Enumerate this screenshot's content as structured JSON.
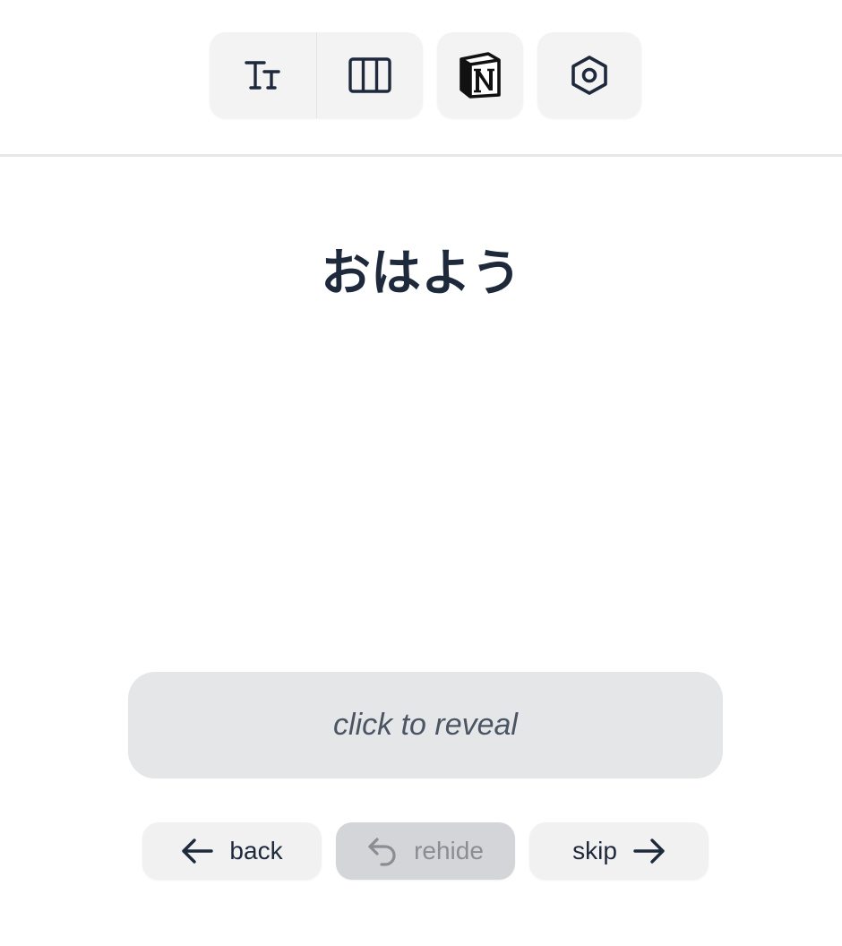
{
  "toolbar": {
    "buttons": [
      {
        "icon": "text-size-icon"
      },
      {
        "icon": "columns-icon"
      },
      {
        "icon": "notion-logo-icon"
      },
      {
        "icon": "settings-hexagon-icon"
      }
    ]
  },
  "card": {
    "word": "おはよう",
    "reveal_label": "click to reveal"
  },
  "nav": {
    "back_label": "back",
    "rehide_label": "rehide",
    "skip_label": "skip"
  },
  "colors": {
    "text": "#1e293b",
    "button_bg": "#f1f1f2",
    "reveal_bg": "#e5e6e7",
    "disabled_bg": "#d4d5d8",
    "disabled_text": "#8a8d93"
  }
}
